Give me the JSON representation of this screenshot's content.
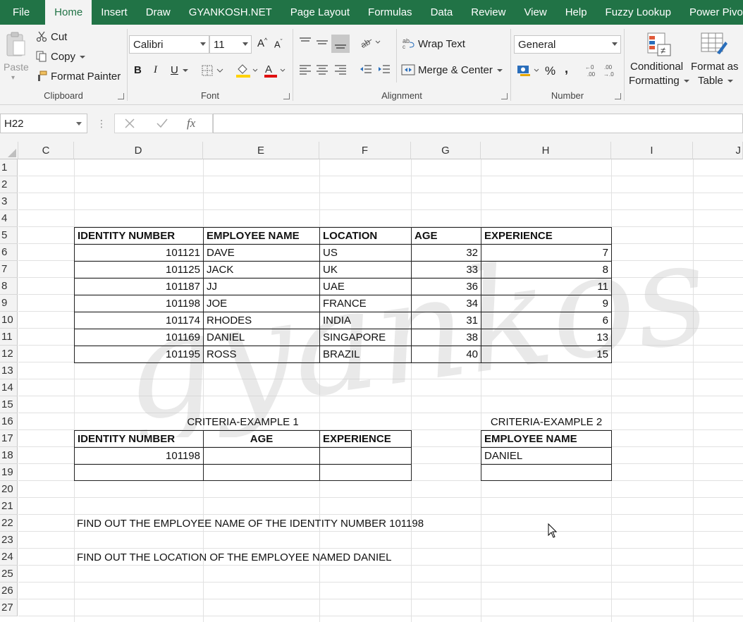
{
  "menu": [
    "File",
    "Home",
    "Insert",
    "Draw",
    "GYANKOSH.NET",
    "Page Layout",
    "Formulas",
    "Data",
    "Review",
    "View",
    "Help",
    "Fuzzy Lookup",
    "Power Pivot"
  ],
  "active_tab": "Home",
  "ribbon": {
    "clipboard": {
      "paste": "Paste",
      "cut": "Cut",
      "copy": "Copy",
      "format_painter": "Format Painter",
      "label": "Clipboard"
    },
    "font": {
      "name": "Calibri",
      "size": "11",
      "bold": "B",
      "italic": "I",
      "underline": "U",
      "label": "Font",
      "grow": "A",
      "shrink": "A"
    },
    "alignment": {
      "wrap_text": "Wrap Text",
      "merge_center": "Merge & Center",
      "label": "Alignment"
    },
    "number": {
      "format": "General",
      "percent": "%",
      "comma": ",",
      "label": "Number"
    },
    "styles": {
      "conditional": "Conditional",
      "conditional2": "Formatting",
      "format_as": "Format as",
      "format_as2": "Table"
    }
  },
  "formula_bar": {
    "name_box": "H22",
    "fx": "fx",
    "content": ""
  },
  "columns": [
    "C",
    "D",
    "E",
    "F",
    "G",
    "H",
    "I",
    "J"
  ],
  "rows": [
    "1",
    "2",
    "3",
    "4",
    "5",
    "6",
    "7",
    "8",
    "9",
    "10",
    "11",
    "12",
    "13",
    "14",
    "15",
    "16",
    "17",
    "18",
    "19",
    "20",
    "21",
    "22",
    "23",
    "24",
    "25",
    "26",
    "27"
  ],
  "main_table": {
    "headers": [
      "IDENTITY NUMBER",
      "EMPLOYEE NAME",
      "LOCATION",
      "AGE",
      "EXPERIENCE"
    ],
    "rows": [
      [
        "101121",
        "DAVE",
        "US",
        "32",
        "7"
      ],
      [
        "101125",
        "JACK",
        "UK",
        "33",
        "8"
      ],
      [
        "101187",
        "JJ",
        "UAE",
        "36",
        "11"
      ],
      [
        "101198",
        "JOE",
        "FRANCE",
        "34",
        "9"
      ],
      [
        "101174",
        "RHODES",
        "INDIA",
        "31",
        "6"
      ],
      [
        "101169",
        "DANIEL",
        "SINGAPORE",
        "38",
        "13"
      ],
      [
        "101195",
        "ROSS",
        "BRAZIL",
        "40",
        "15"
      ]
    ]
  },
  "criteria1": {
    "title": "CRITERIA-EXAMPLE 1",
    "headers": [
      "IDENTITY NUMBER",
      "AGE",
      "EXPERIENCE"
    ],
    "value": "101198"
  },
  "criteria2": {
    "title": "CRITERIA-EXAMPLE 2",
    "header": "EMPLOYEE NAME",
    "value": "DANIEL"
  },
  "questions": {
    "q1": "FIND OUT THE EMPLOYEE NAME OF THE IDENTITY NUMBER 101198",
    "q2": "FIND OUT THE LOCATION OF THE EMPLOYEE NAMED DANIEL"
  },
  "watermark_text": "gyankosh.net",
  "colors": {
    "excel_green": "#217346",
    "ribbon_bg": "#f3f3f3"
  }
}
